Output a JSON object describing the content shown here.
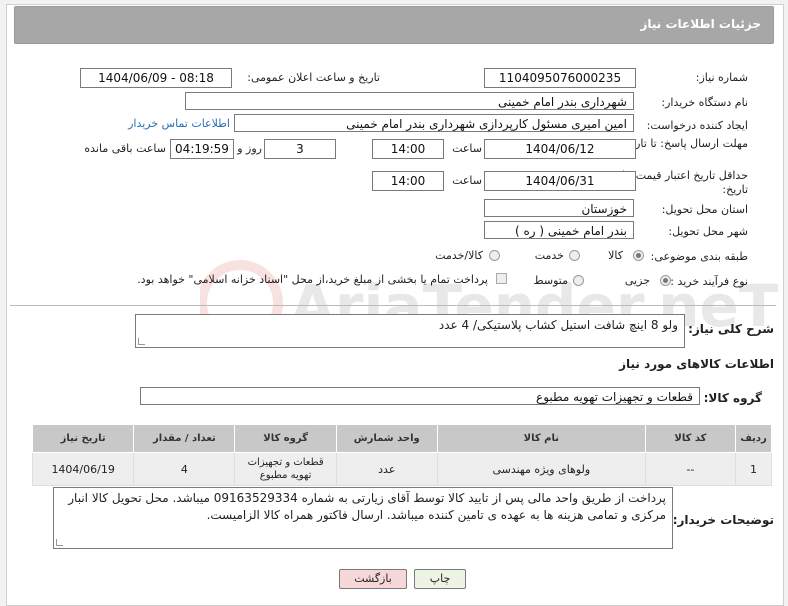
{
  "header": {
    "title": "جزئیات اطلاعات نیاز"
  },
  "fields": {
    "need_number_label": "شماره نیاز:",
    "need_number": "1104095076000235",
    "announce_label": "تاریخ و ساعت اعلان عمومی:",
    "announce_value": "1404/06/09 - 08:18",
    "buyer_org_label": "نام دستگاه خریدار:",
    "buyer_org": "شهرداری بندر امام خمینی",
    "creator_label": "ایجاد کننده درخواست:",
    "creator": "امین امیری مسئول کارپردازی شهرداری بندر امام خمینی",
    "contact_link": "اطلاعات تماس خریدار",
    "deadline_label": "مهلت ارسال پاسخ: تا تاریخ:",
    "deadline_date": "1404/06/12",
    "time_label": "ساعت",
    "deadline_time": "14:00",
    "days_value": "3",
    "days_label": "روز و",
    "remaining_value": "04:19:59",
    "remaining_label": "ساعت باقی مانده",
    "min_price_label": "حداقل تاریخ اعتبار قیمت: تا تاریخ:",
    "min_price_date": "1404/06/31",
    "min_price_time": "14:00",
    "province_label": "استان محل تحویل:",
    "province": "خوزستان",
    "city_label": "شهر محل تحویل:",
    "city": "بندر امام خمینی ( ره )",
    "category_label": "طبقه بندی موضوعی:",
    "category_opts": [
      "کالا",
      "خدمت",
      "کالا/خدمت"
    ],
    "process_label": "نوع فرآیند خرید :",
    "process_opts": [
      "جزیی",
      "متوسط"
    ],
    "payment_note": "پرداخت تمام یا بخشی از مبلغ خرید،از محل \"اسناد خزانه اسلامی\" خواهد بود."
  },
  "summary": {
    "label": "شرح کلی نیاز:",
    "text": "ولو 8 اینچ شافت استیل کشاب پلاستیکی/ 4 عدد"
  },
  "goods": {
    "section_title": "اطلاعات کالاهای مورد نیاز",
    "group_label": "گروه کالا:",
    "group_value": "قطعات و تجهیزات تهویه مطبوع",
    "columns": [
      "ردیف",
      "کد کالا",
      "نام کالا",
      "واحد شمارش",
      "گروه کالا",
      "تعداد / مقدار",
      "تاریخ نیاز"
    ],
    "rows": [
      {
        "idx": "1",
        "code": "--",
        "name": "ولوهای ویژه مهندسی",
        "unit": "عدد",
        "group": "قطعات و تجهیزات تهویه مطبوع",
        "qty": "4",
        "date": "1404/06/19"
      }
    ]
  },
  "buyer_notes": {
    "label": "توضیحات خریدار:",
    "text": "پرداخت از طریق واحد مالی پس از تایید کالا توسط آقای زیارتی به شماره 09163529334 میباشد. محل تحویل کالا انبار مرکزی و تمامی هزینه ها به عهده ی تامین کننده میباشد. ارسال فاکتور همراه کالا الزامیست."
  },
  "buttons": {
    "print": "چاپ",
    "back": "بازگشت"
  },
  "watermark": {
    "text": "AriaTender.neT"
  },
  "colors": {
    "header": "#a7a7a7",
    "link": "#2b6fb4",
    "back_button": "#f6d8d8",
    "print_button": "#eef4e4"
  }
}
